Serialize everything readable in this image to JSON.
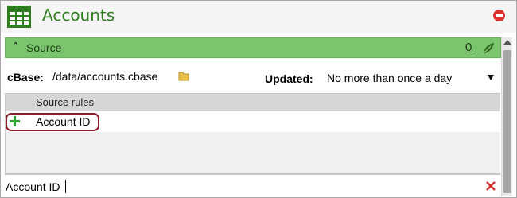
{
  "window": {
    "title": "Accounts",
    "accent_color": "#2e7d1f",
    "close_icon": "close-icon"
  },
  "source_section": {
    "title": "Source",
    "count": "0",
    "header_color": "#7ac56d",
    "collapse_icon": "chevron-double-up-icon",
    "leaf_icon": "leaf-icon"
  },
  "cbase": {
    "label": "cBase:",
    "path": "/data/accounts.cbase",
    "folder_icon": "folder-icon"
  },
  "updated": {
    "label": "Updated:",
    "value": "No more than once a day"
  },
  "rules": {
    "header": "Source rules",
    "items": [
      {
        "label": "Account ID",
        "icon": "plus-icon"
      }
    ]
  },
  "input": {
    "value": "Account ID",
    "clear_icon": "clear-icon"
  }
}
